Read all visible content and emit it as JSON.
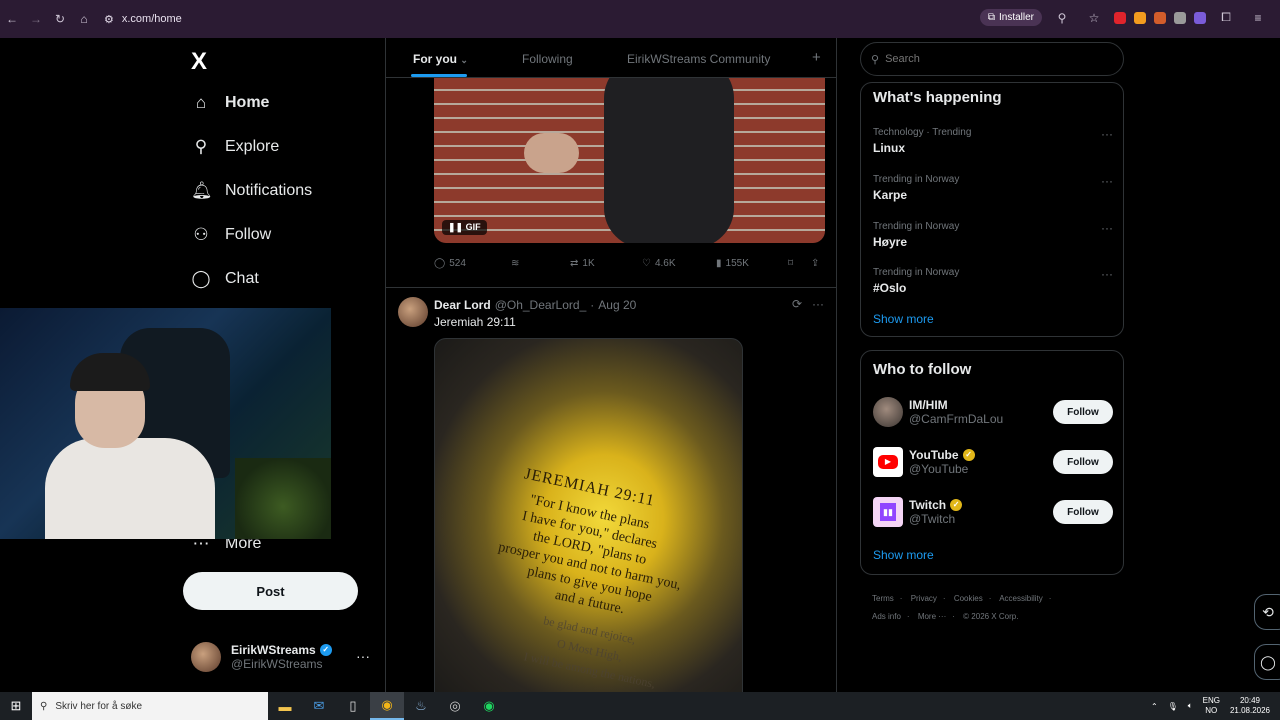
{
  "browser": {
    "url": "x.com/home",
    "install_label": "Installer"
  },
  "nav": {
    "logo": "X",
    "items": [
      {
        "label": "Home",
        "icon": "home-icon"
      },
      {
        "label": "Explore",
        "icon": "search-icon"
      },
      {
        "label": "Notifications",
        "icon": "bell-icon"
      },
      {
        "label": "Follow",
        "icon": "person-add-icon"
      },
      {
        "label": "Chat",
        "icon": "chat-icon"
      },
      {
        "label": "More",
        "icon": "more-circle-icon"
      }
    ],
    "post_label": "Post"
  },
  "account": {
    "name": "EirikWStreams",
    "handle": "@EirikWStreams"
  },
  "tabs": {
    "for_you": "For you",
    "following": "Following",
    "community": "EirikWStreams Community"
  },
  "tweet1": {
    "gif_badge": "GIF",
    "replies": "524",
    "retweets": "1K",
    "likes": "4.6K",
    "views": "155K"
  },
  "tweet2": {
    "name": "Dear Lord",
    "handle": "@Oh_DearLord_",
    "dot": "·",
    "date": "Aug 20",
    "text": "Jeremiah 29:11",
    "image_text": {
      "title": "JEREMIAH 29:11",
      "lines": [
        "\"For I know the plans",
        "I have for you,\" declares",
        "the LORD, \"plans to",
        "prosper you and not to harm you,",
        "plans to give you hope",
        "and a future."
      ],
      "faint_lines": [
        "be glad and rejoice,",
        "O Most High,",
        "I will be among the nations,"
      ]
    }
  },
  "search": {
    "placeholder": "Search"
  },
  "whats_happening": {
    "title": "What's happening",
    "trends": [
      {
        "context": "Technology · Trending",
        "title": "Linux"
      },
      {
        "context": "Trending in Norway",
        "title": "Karpe"
      },
      {
        "context": "Trending in Norway",
        "title": "Høyre"
      },
      {
        "context": "Trending in Norway",
        "title": "#Oslo"
      }
    ],
    "show_more": "Show more"
  },
  "who_to_follow": {
    "title": "Who to follow",
    "accounts": [
      {
        "name": "IM/HIM",
        "handle": "@CamFrmDaLou",
        "verified": false
      },
      {
        "name": "YouTube",
        "handle": "@YouTube",
        "verified": true
      },
      {
        "name": "Twitch",
        "handle": "@Twitch",
        "verified": true
      }
    ],
    "follow_label": "Follow",
    "show_more": "Show more"
  },
  "footer": {
    "links": [
      "Terms",
      "Privacy",
      "Cookies",
      "Accessibility",
      "Ads info",
      "More ···",
      "© 2026 X Corp."
    ]
  },
  "taskbar": {
    "search_placeholder": "Skriv her for å søke",
    "lang_top": "ENG",
    "lang_bottom": "NO",
    "time": "20:49",
    "date": "21.08.2026"
  },
  "colors": {
    "accent": "#1d9bf0",
    "background": "#000000",
    "border": "#2f3336",
    "muted": "#71767b",
    "gold_verified": "#e2b719"
  }
}
